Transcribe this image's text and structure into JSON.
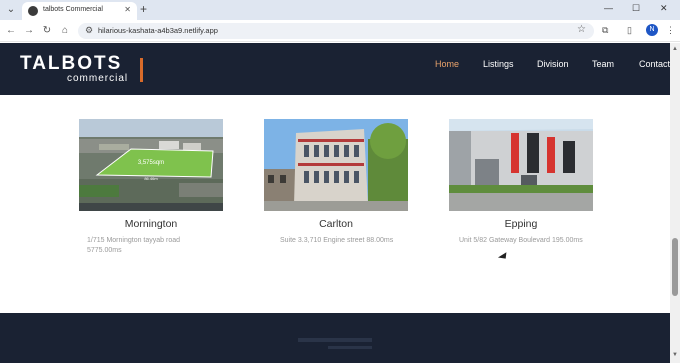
{
  "browser": {
    "tab_title": "talbots Commercial",
    "url": "hilarious-kashata-a4b3a9.netlify.app",
    "profile_initial": "N",
    "icons": [
      "chevron-down-icon",
      "close-icon",
      "plus-icon",
      "back-icon",
      "forward-icon",
      "reload-icon",
      "home-icon",
      "tune-icon",
      "star-icon",
      "extensions-icon",
      "sidebar-icon",
      "more-icon"
    ]
  },
  "header": {
    "logo_main": "TALBOTS",
    "logo_sub": "commercial",
    "accent_color": "#d86b2a",
    "nav": [
      {
        "label": "Home",
        "active": true
      },
      {
        "label": "Listings"
      },
      {
        "label": "Division"
      },
      {
        "label": "Team"
      },
      {
        "label": "Contact"
      }
    ]
  },
  "listings": [
    {
      "city": "Mornington",
      "address_line1": "1/715 Mornington tayyab road",
      "address_line2": "5775.00ms",
      "image_label": "3,575sqm",
      "image_dim": "86.46m"
    },
    {
      "city": "Carlton",
      "address_line1": "Suite 3.3,710 Engine street 88.00ms"
    },
    {
      "city": "Epping",
      "address_line1": "Unit 5/82 Gateway Boulevard 195.00ms"
    }
  ],
  "colors": {
    "navy": "#1a2233",
    "active_nav": "#e9a36b"
  }
}
